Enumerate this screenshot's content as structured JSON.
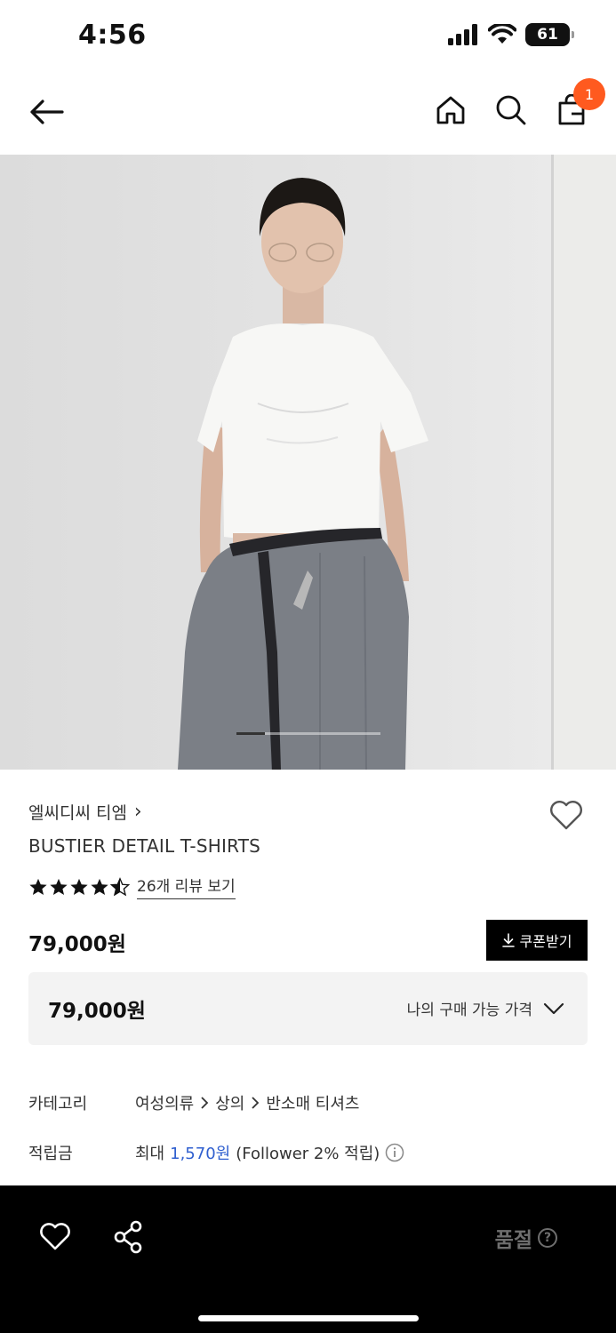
{
  "status_bar": {
    "time": "4:56",
    "battery": "61",
    "icons": [
      "cellular-signal-icon",
      "wifi-icon",
      "battery-icon"
    ]
  },
  "nav": {
    "cart_badge": "1",
    "icons": [
      "back-arrow-icon",
      "home-icon",
      "search-icon",
      "shopping-bag-icon"
    ]
  },
  "hero": {
    "image_count_indicator": "image carousel"
  },
  "product": {
    "brand": "엘씨디씨 티엠",
    "brand_chevron": "›",
    "name": "BUSTIER DETAIL T-SHIRTS",
    "rating": 4.5,
    "reviews_link": "26개 리뷰 보기",
    "price": "79,000원",
    "coupon_button": "쿠폰받기",
    "my_price_value": "79,000원",
    "my_price_label": "나의 구매 가능 가격"
  },
  "details": {
    "category_key": "카테고리",
    "category_path": [
      "여성의류",
      "상의",
      "반소매 티셔츠"
    ],
    "points_key": "적립금",
    "points_prefix": "최대",
    "points_value": "1,570원",
    "points_suffix": "(Follower 2% 적립)"
  },
  "bottom_bar": {
    "status": "품절",
    "help": "?"
  },
  "colors": {
    "badge": "#ff5a1f",
    "link_blue": "#2f5fcf",
    "bottom_bar": "#000000",
    "soldout_text": "#6e6e6e"
  }
}
